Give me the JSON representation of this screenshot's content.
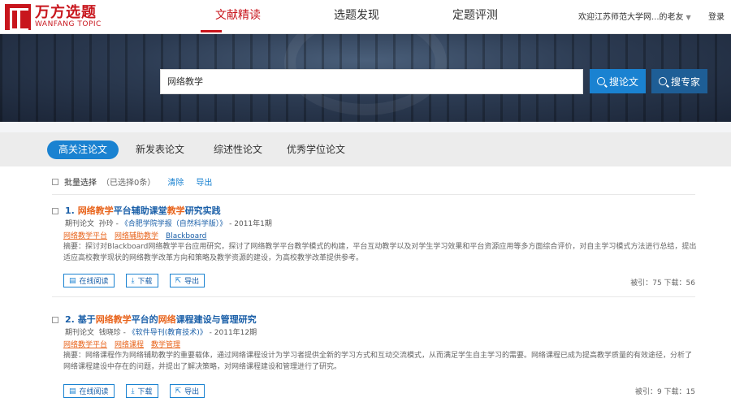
{
  "header": {
    "logo_cn": "万方选题",
    "logo_en": "WANFANG TOPIC",
    "nav": [
      "文献精读",
      "选题发现",
      "定题评测"
    ],
    "active_nav": 0,
    "user_text": "欢迎江苏师范大学网...的老友",
    "logout_label": "登录"
  },
  "search": {
    "value": "网络教学",
    "paper_button": "搜论文",
    "expert_button": "搜专家"
  },
  "tabs": [
    "高关注论文",
    "新发表论文",
    "综述性论文",
    "优秀学位论文"
  ],
  "active_tab": 0,
  "batch": {
    "select_label": "批量选择",
    "count_text": "（已选择0条）",
    "clear_label": "清除",
    "export_label": "导出"
  },
  "results": [
    {
      "num": "1.",
      "title_parts": [
        {
          "t": "网络教学",
          "hl": true
        },
        {
          "t": "平台辅助课堂",
          "hl": false
        },
        {
          "t": "教学",
          "hl": true
        },
        {
          "t": "研究实践",
          "hl": false
        }
      ],
      "type": "期刊论文",
      "author": "孙玲",
      "journal": "《合肥学院学报（自然科学版）》",
      "date": "2011年1期",
      "tags": [
        {
          "t": "网络教学平台",
          "hl": true
        },
        {
          "t": "网络辅助教学",
          "hl": true
        },
        {
          "t": "Blackboard",
          "hl": false
        }
      ],
      "abstract": "摘要：探讨对Blackboard网络教学平台应用研究，探讨了网络教学平台教学模式的构建，平台互动教学以及对学生学习效果和平台资源应用等多方面综合评价，对自主学习模式方法进行总结，提出适应高校教学现状的网络教学改革方向和策略及教学资源的建设，为高校教学改革提供参考。",
      "actions": [
        "在线阅读",
        "下载",
        "导出"
      ],
      "stats": "被引：75  下载：56"
    },
    {
      "num": "2.",
      "title_parts": [
        {
          "t": "基于",
          "hl": false
        },
        {
          "t": "网络教学",
          "hl": true
        },
        {
          "t": "平台的",
          "hl": false
        },
        {
          "t": "网络",
          "hl": true
        },
        {
          "t": "课程建设与管理研究",
          "hl": false
        }
      ],
      "type": "期刊论文",
      "author": "钱晓珍",
      "journal": "《软件导刊(教育技术)》",
      "date": "2011年12期",
      "tags": [
        {
          "t": "网络教学平台",
          "hl": true
        },
        {
          "t": "网络课程",
          "hl": true
        },
        {
          "t": "教学管理",
          "hl": true
        }
      ],
      "abstract": "摘要：网络课程作为网络辅助教学的重要载体，通过网络课程设计为学习者提供全新的学习方式和互动交流模式，从而满足学生自主学习的需要。网络课程已成为提高教学质量的有效途径，分析了网络课程建设中存在的问题，并提出了解决策略，对网络课程建设和管理进行了研究。",
      "actions": [
        "在线阅读",
        "下载",
        "导出"
      ],
      "stats": "被引：9  下载：15"
    }
  ]
}
